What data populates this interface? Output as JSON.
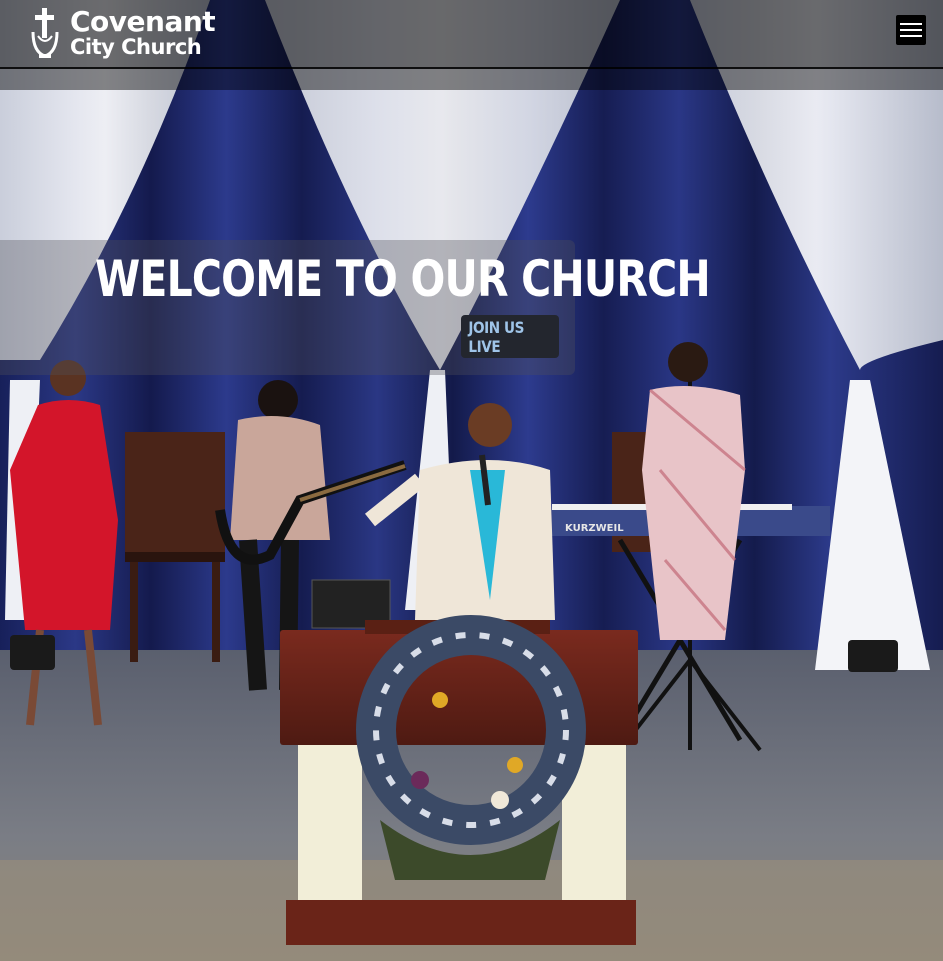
{
  "brand": {
    "name_line1": "Covenant",
    "name_line2": "City Church"
  },
  "nav": {
    "menu_icon": "hamburger-menu-icon"
  },
  "hero": {
    "title": "WELCOME TO OUR CHURCH",
    "cta_label": "JOIN US LIVE",
    "keyboard_brand": "KURZWEIL"
  },
  "colors": {
    "header_bg": "#000000",
    "cta_bg": "#23262e",
    "cta_text": "#9fc4e8",
    "curtain": "#1f2a6e"
  }
}
